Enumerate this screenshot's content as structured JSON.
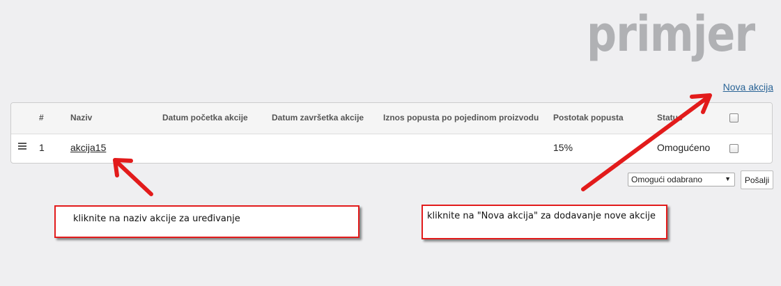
{
  "watermark": "primjer",
  "new_action_link": "Nova akcija",
  "table": {
    "columns": {
      "number": "#",
      "name": "Naziv",
      "start_date": "Datum početka akcije",
      "end_date": "Datum završetka akcije",
      "discount_amount": "Iznos popusta po pojedinom proizvodu",
      "discount_percent": "Postotak popusta",
      "status": "Status"
    },
    "rows": [
      {
        "number": "1",
        "name": "akcija15",
        "start_date": "",
        "end_date": "",
        "discount_amount": "",
        "discount_percent": "15%",
        "status": "Omogućeno",
        "checked": false
      }
    ]
  },
  "bulk_action": {
    "selected": "Omogući odabrano"
  },
  "submit_button": "Pošalji",
  "callouts": [
    {
      "text": "kliknite na naziv akcije za uređivanje"
    },
    {
      "text": "kliknite na \"Nova akcija\" za dodavanje nove akcije"
    }
  ],
  "colors": {
    "link": "#2a6496",
    "annotation": "#e21b1b",
    "watermark": "#b0b1b4"
  }
}
